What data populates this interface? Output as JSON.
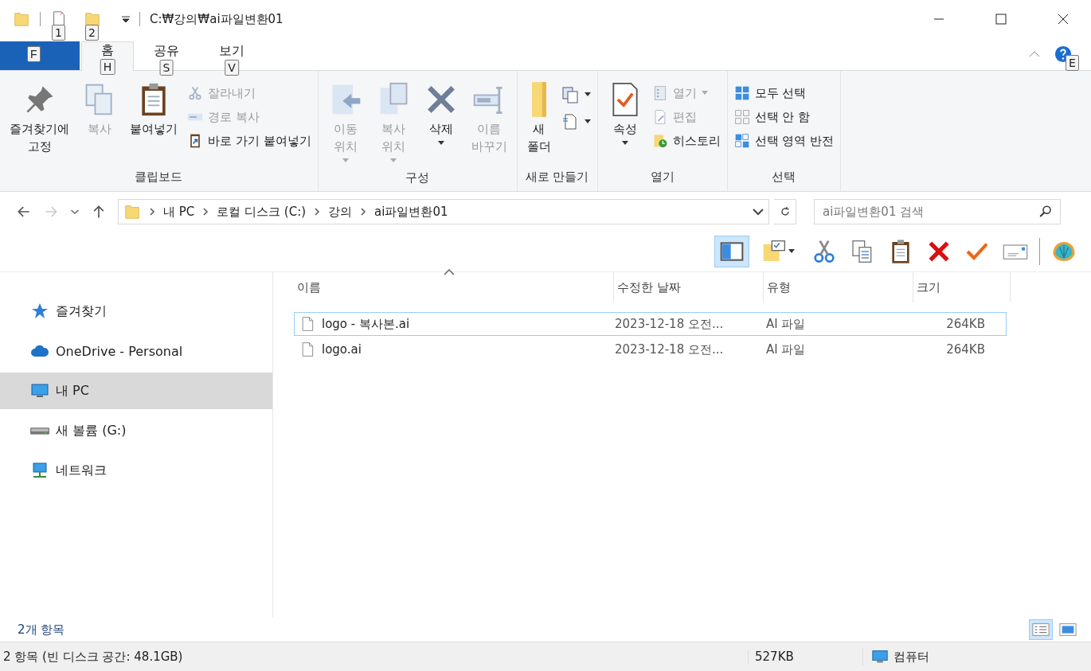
{
  "title_bar": {
    "quick_access_key_tips": [
      "1",
      "2"
    ],
    "title": "C:₩강의₩ai파일변환01"
  },
  "ribbon_tabs": [
    {
      "kind": "file",
      "key_tip": "F",
      "selected": false
    },
    {
      "kind": "tab",
      "label": "홈",
      "key_tip": "H",
      "selected": true
    },
    {
      "kind": "tab",
      "label": "공유",
      "key_tip": "S",
      "selected": false
    },
    {
      "kind": "tab",
      "label": "보기",
      "key_tip": "V",
      "selected": false
    }
  ],
  "help_key_tip": "E",
  "ribbon_groups": [
    {
      "label": "클립보드",
      "items": [
        {
          "kind": "large",
          "label": "즐겨찾기에\n고정",
          "disabled": false,
          "dropdown": false
        },
        {
          "kind": "large",
          "label": "복사",
          "disabled": true,
          "dropdown": false
        },
        {
          "kind": "large",
          "label": "붙여넣기",
          "disabled": false,
          "dropdown": false
        },
        {
          "kind": "stack",
          "items": [
            {
              "label": "잘라내기",
              "disabled": true,
              "dropdown": false
            },
            {
              "label": "경로 복사",
              "disabled": true,
              "dropdown": false
            },
            {
              "label": "바로 가기 붙여넣기",
              "disabled": false,
              "dropdown": false
            }
          ]
        }
      ]
    },
    {
      "label": "구성",
      "items": [
        {
          "kind": "large",
          "label": "이동\n위치",
          "disabled": true,
          "dropdown": true
        },
        {
          "kind": "large",
          "label": "복사\n위치",
          "disabled": true,
          "dropdown": true
        },
        {
          "kind": "large",
          "label": "삭제",
          "disabled": false,
          "dropdown": true
        },
        {
          "kind": "large",
          "label": "이름\n바꾸기",
          "disabled": true,
          "dropdown": false
        }
      ]
    },
    {
      "label": "새로 만들기",
      "items": [
        {
          "kind": "large",
          "label": "새\n폴더",
          "disabled": false,
          "dropdown": false
        },
        {
          "kind": "iconstack",
          "items": [
            {
              "dropdown": true
            },
            {
              "dropdown": true
            }
          ]
        }
      ]
    },
    {
      "label": "열기",
      "items": [
        {
          "kind": "large",
          "label": "속성",
          "disabled": false,
          "dropdown": true
        },
        {
          "kind": "stack",
          "items": [
            {
              "label": "열기",
              "disabled": true,
              "dropdown": true
            },
            {
              "label": "편집",
              "disabled": true,
              "dropdown": false
            },
            {
              "label": "히스토리",
              "disabled": false,
              "dropdown": false
            }
          ]
        }
      ]
    },
    {
      "label": "선택",
      "items": [
        {
          "kind": "stack",
          "items": [
            {
              "label": "모두 선택",
              "disabled": false,
              "dropdown": false
            },
            {
              "label": "선택 안 함",
              "disabled": false,
              "dropdown": false
            },
            {
              "label": "선택 영역 반전",
              "disabled": false,
              "dropdown": false
            }
          ]
        }
      ]
    }
  ],
  "navigation": {
    "back_disabled": false,
    "forward_disabled": true
  },
  "breadcrumb": [
    "내 PC",
    "로컬 디스크 (C:)",
    "강의",
    "ai파일변환01"
  ],
  "search": {
    "placeholder": "ai파일변환01 검색"
  },
  "toolbar": [
    {
      "kind": "pane",
      "selected": true
    },
    {
      "kind": "properties",
      "selected": false
    },
    {
      "kind": "cut",
      "selected": false
    },
    {
      "kind": "copy",
      "selected": false
    },
    {
      "kind": "paste",
      "selected": false
    },
    {
      "kind": "delete",
      "selected": false
    },
    {
      "kind": "check",
      "selected": false
    },
    {
      "kind": "mail",
      "selected": false
    },
    {
      "kind": "shell",
      "selected": false
    }
  ],
  "sidebar": {
    "items": [
      {
        "kind": "star",
        "label": "즐겨찾기",
        "selected": false
      },
      {
        "kind": "cloud",
        "label": "OneDrive - Personal",
        "selected": false
      },
      {
        "kind": "pc",
        "label": "내 PC",
        "selected": true
      },
      {
        "kind": "drive",
        "label": "새 볼륨 (G:)",
        "selected": false
      },
      {
        "kind": "network",
        "label": "네트워크",
        "selected": false
      }
    ]
  },
  "file_list": {
    "columns": [
      "이름",
      "수정한 날짜",
      "유형",
      "크기"
    ],
    "rows": [
      {
        "name": "logo - 복사본.ai",
        "modified": "2023-12-18 오전...",
        "type": "AI 파일",
        "size": "264KB",
        "focused": true
      },
      {
        "name": "logo.ai",
        "modified": "2023-12-18 오전...",
        "type": "AI 파일",
        "size": "264KB",
        "focused": false
      }
    ]
  },
  "item_count": "2개 항목",
  "views": [
    {
      "kind": "details",
      "selected": true
    },
    {
      "kind": "large_icons",
      "selected": false
    }
  ],
  "status_bar": {
    "summary": "2 항목 (빈 디스크 공간: 48.1GB)",
    "size": "527KB",
    "location": "컴퓨터"
  }
}
